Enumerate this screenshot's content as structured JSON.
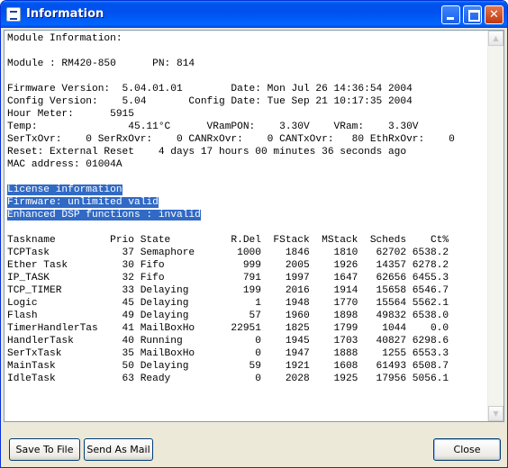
{
  "window": {
    "title": "Information",
    "controls": {
      "minimize": "_",
      "maximize": "□",
      "close": "✕"
    }
  },
  "content": {
    "lines": [
      "Module Information:",
      "",
      "Module : RM420-850      PN: 814",
      "",
      "Firmware Version:  5.04.01.01        Date: Mon Jul 26 14:36:54 2004",
      "Config Version:    5.04       Config Date: Tue Sep 21 10:17:35 2004",
      "Hour Meter:      5915",
      "Temp:               45.11°C      VRamPON:    3.30V    VRam:    3.30V",
      "SerTxOvr:    0 SerRxOvr:    0 CANRxOvr:    0 CANTxOvr:   80 EthRxOvr:    0",
      "Reset: External Reset    4 days 17 hours 00 minutes 36 seconds ago",
      "MAC address: 01004A",
      "",
      "License information",
      "Firmware: unlimited valid",
      "Enhanced DSP functions : invalid",
      "",
      "Taskname         Prio State          R.Del  FStack  MStack  Scheds    Ct%",
      "TCPTask            37 Semaphore       1000    1846    1810   62702 6538.2",
      "Ether Task         30 Fifo             999    2005    1926   14357 6278.2",
      "IP_TASK            32 Fifo             791    1997    1647   62656 6455.3",
      "TCP_TIMER          33 Delaying         199    2016    1914   15658 6546.7",
      "Logic              45 Delaying           1    1948    1770   15564 5562.1",
      "Flash              49 Delaying          57    1960    1898   49832 6538.0",
      "TimerHandlerTas    41 MailBoxHo      22951    1825    1799    1044    0.0",
      "HandlerTask        40 Running            0    1945    1703   40827 6298.6",
      "SerTxTask          35 MailBoxHo          0    1947    1888    1255 6553.3",
      "MainTask           50 Delaying          59    1921    1608   61493 6508.7",
      "IdleTask           63 Ready              0    2028    1925   17956 5056.1"
    ]
  },
  "scrollbar": {
    "up_arrow": "▲",
    "down_arrow": "▼"
  },
  "buttons": {
    "save": "Save To File",
    "mail": "Send As Mail",
    "close": "Close"
  },
  "colors": {
    "title_bar": "#0054e3",
    "selection": "#316ac5",
    "close_button": "#c1380f"
  }
}
